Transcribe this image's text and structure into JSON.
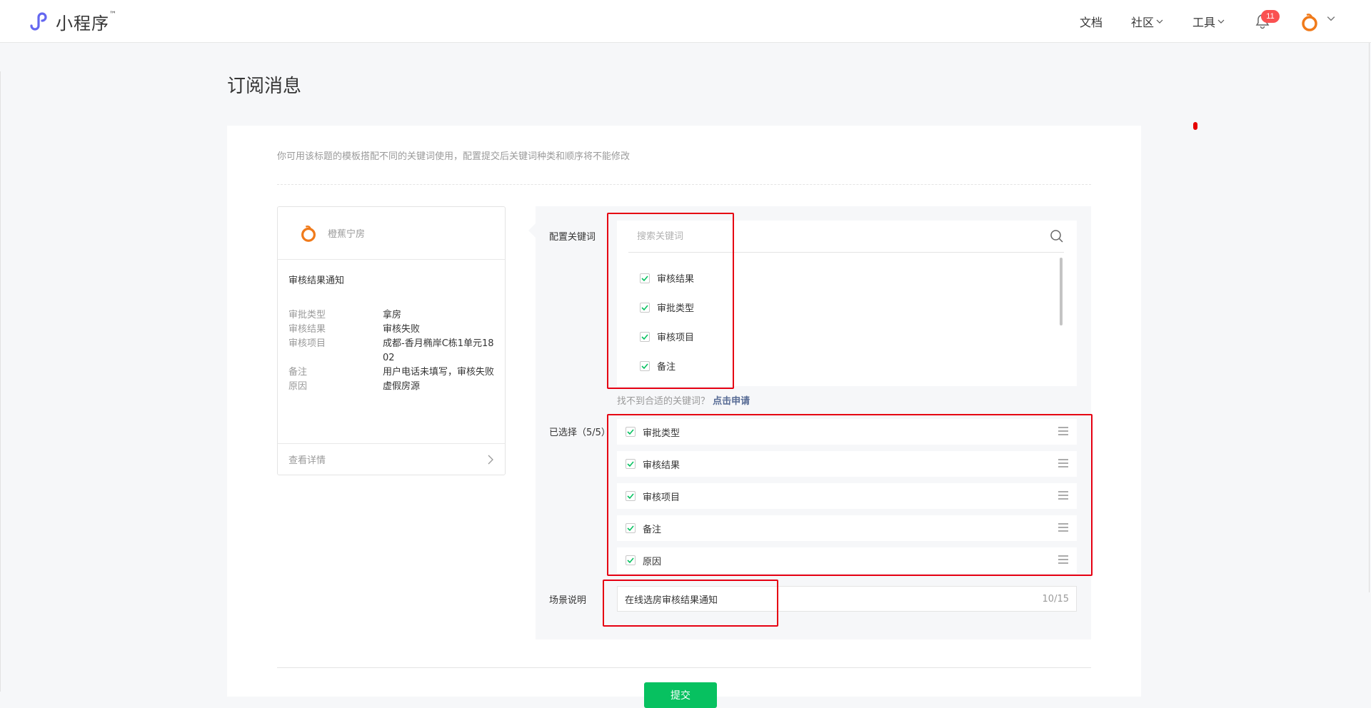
{
  "header": {
    "logo_text": "小程序",
    "logo_tm": "™",
    "nav": {
      "docs": "文档",
      "community": "社区",
      "tools": "工具"
    },
    "notification_count": "11"
  },
  "page": {
    "title": "订阅消息",
    "tip": "你可用该标题的模板搭配不同的关键词使用，配置提交后关键词种类和顺序将不能修改"
  },
  "preview": {
    "brand_name": "橙蕉宁房",
    "title": "审核结果通知",
    "rows": [
      {
        "label": "审批类型",
        "value": "拿房"
      },
      {
        "label": "审核结果",
        "value": "审核失败"
      },
      {
        "label": "审核项目",
        "value": "成都-香月椭岸C栋1单元1802"
      },
      {
        "label": "备注",
        "value": "用户电话未填写，审核失败"
      },
      {
        "label": "原因",
        "value": "虚假房源"
      }
    ],
    "footer": "查看详情"
  },
  "config": {
    "keyword_label": "配置关键词",
    "search_placeholder": "搜索关键词",
    "keywords": [
      "审核结果",
      "审批类型",
      "审核项目",
      "备注"
    ],
    "hint": "找不到合适的关键词？",
    "hint_link": "点击申请",
    "selected_label": "已选择（5/5）",
    "selected": [
      "审批类型",
      "审核结果",
      "审核项目",
      "备注",
      "原因"
    ],
    "scene_label": "场景说明",
    "scene_value": "在线选房审核结果通知",
    "scene_count": "10/15"
  },
  "submit_label": "提交",
  "colors": {
    "accent_green": "#07c160",
    "link": "#576b95",
    "badge": "#fa5151",
    "annotation": "#e60012"
  }
}
